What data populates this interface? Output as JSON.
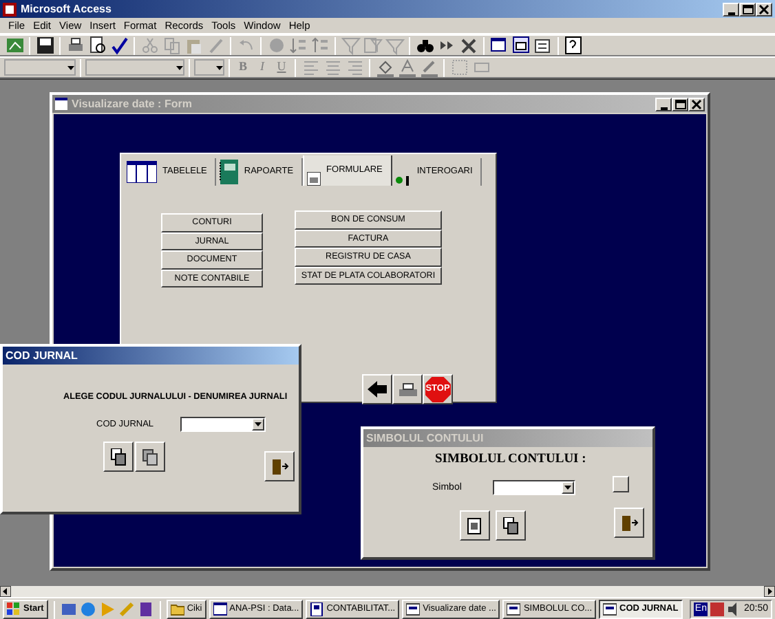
{
  "window": {
    "title": "Microsoft Access"
  },
  "menu": [
    "File",
    "Edit",
    "View",
    "Insert",
    "Format",
    "Records",
    "Tools",
    "Window",
    "Help"
  ],
  "format_toolbar": {
    "style_buttons": [
      "B",
      "I",
      "U"
    ]
  },
  "form_window": {
    "title": "Visualizare date : Form",
    "active": false,
    "tabs": [
      {
        "label": "TABELELE",
        "kind": "table",
        "selected": false
      },
      {
        "label": "RAPOARTE",
        "kind": "report",
        "selected": false
      },
      {
        "label": "FORMULARE",
        "kind": "form",
        "selected": true
      },
      {
        "label": "INTEROGARI",
        "kind": "query",
        "selected": false
      }
    ],
    "left_buttons": [
      "CONTURI",
      "JURNAL",
      "DOCUMENT",
      "NOTE CONTABILE"
    ],
    "right_buttons": [
      "BON DE CONSUM",
      "FACTURA",
      "REGISTRU DE CASA",
      "STAT DE PLATA COLABORATORI"
    ],
    "nav_buttons": [
      {
        "kind": "back"
      },
      {
        "kind": "print"
      },
      {
        "kind": "stop",
        "label": "STOP"
      }
    ]
  },
  "cod_jurnal_window": {
    "title": "COD JURNAL",
    "active": true,
    "heading": "ALEGE CODUL JURNALULUI - DENUMIREA JURNALI",
    "field_label": "COD JURNAL"
  },
  "simbol_window": {
    "title": "SIMBOLUL CONTULUI",
    "active": false,
    "heading": "SIMBOLUL CONTULUI :",
    "field_label": "Simbol"
  },
  "taskbar": {
    "start": "Start",
    "tasks": [
      {
        "label": "Ciki",
        "kind": "folder",
        "selected": false
      },
      {
        "label": "ANA-PSI : Data...",
        "kind": "database",
        "selected": false
      },
      {
        "label": "CONTABILITAT...",
        "kind": "document",
        "selected": false
      },
      {
        "label": "Visualizare date ...",
        "kind": "form",
        "selected": false
      },
      {
        "label": "SIMBOLUL CO...",
        "kind": "form",
        "selected": false
      },
      {
        "label": "COD JURNAL",
        "kind": "form",
        "selected": true
      }
    ],
    "language": "En",
    "clock": "20:50"
  }
}
